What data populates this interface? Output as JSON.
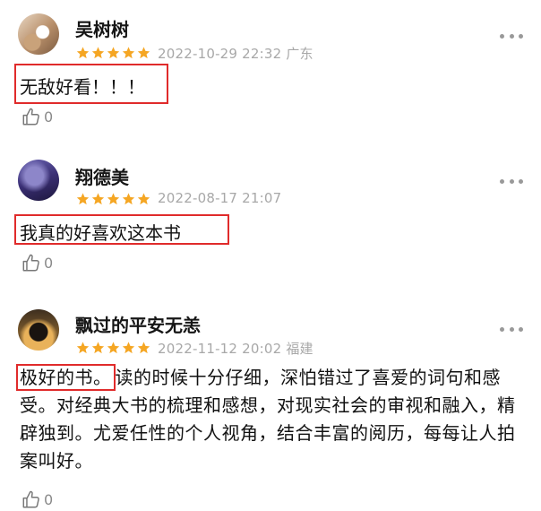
{
  "reviews": [
    {
      "username": "吴树树",
      "rating": 5,
      "datetime": "2022-10-29 22:32",
      "location": "广东",
      "content": "无敌好看！！！",
      "likes": "0"
    },
    {
      "username": "翔德美",
      "rating": 5,
      "datetime": "2022-08-17 21:07",
      "location": "",
      "content": "我真的好喜欢这本书",
      "likes": "0"
    },
    {
      "username": "飘过的平安无恙",
      "rating": 5,
      "datetime": "2022-11-12 20:02",
      "location": "福建",
      "content_highlight": "极好的书。",
      "content_rest": "读的时候十分仔细，深怕错过了喜爱的词句和感受。对经典大书的梳理和感想，对现实社会的审视和融入，精辟独到。尤爱任性的个人视角，结合丰富的阅历，每每让人拍案叫好。",
      "likes": "0"
    }
  ],
  "colors": {
    "star": "#f5a623",
    "highlight_border": "#e02b2b",
    "meta": "#a8a8a8"
  },
  "icons": {
    "more": "more-dots-icon",
    "like": "thumbs-up-icon",
    "star": "star-icon"
  }
}
